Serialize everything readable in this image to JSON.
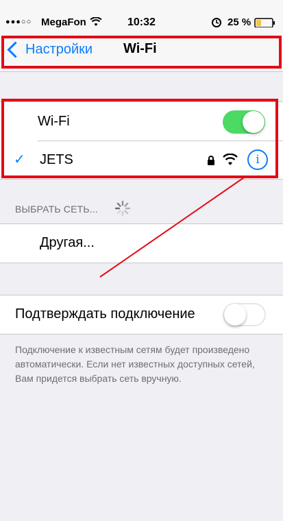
{
  "status_bar": {
    "signal": "●●●○○",
    "carrier": "MegaFon",
    "time": "10:32",
    "battery": "25 %"
  },
  "nav": {
    "back_label": "Настройки",
    "title": "Wi-Fi"
  },
  "wifi": {
    "label": "Wi-Fi",
    "enabled": true
  },
  "current_network": {
    "checkmark": "✓",
    "name": "JETS",
    "info": "i"
  },
  "choose_network": {
    "header": "ВЫБРАТЬ СЕТЬ...",
    "other": "Другая..."
  },
  "ask_to_join": {
    "label": "Подтверждать подключение",
    "enabled": false
  },
  "footer": {
    "text": "Подключение к известным сетям будет произведено автоматически. Если нет известных доступных сетей, Вам придется выбрать сеть вручную."
  },
  "colors": {
    "accent": "#0a7cff",
    "toggle_on": "#4cd964",
    "annotation_red": "#e20c17",
    "background": "#efeff4"
  },
  "icons": [
    "wifi-icon",
    "lock-icon",
    "info-icon",
    "alarm-icon",
    "battery-icon",
    "spinner-icon",
    "chevron-left-icon"
  ]
}
